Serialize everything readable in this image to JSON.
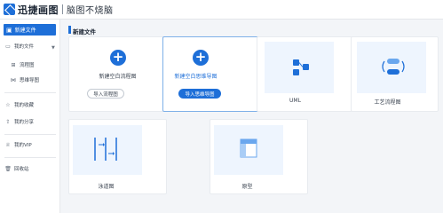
{
  "app": {
    "brand": "迅捷画图",
    "subtitle": "脑图不烧脑"
  },
  "sidebar": {
    "new_file": "新建文件",
    "my_files": "我的文件",
    "flowchart": "流程图",
    "mindmap": "思维导图",
    "favorites": "我的收藏",
    "share": "我的分享",
    "vip": "我的VIP",
    "recycle": "回收站"
  },
  "main": {
    "section_title": "新建文件",
    "cards": {
      "flowchart": {
        "label": "新建空白流程图",
        "button": "导入流程图"
      },
      "mindmap": {
        "label": "新建空白思维导图",
        "button": "导入思维导图"
      },
      "uml": {
        "label": "UML"
      },
      "process": {
        "label": "工艺流程图"
      },
      "swimlane": {
        "label": "泳道图"
      },
      "prototype": {
        "label": "原型"
      }
    }
  },
  "colors": {
    "accent": "#1e6fd8",
    "thumb_bg": "#eef5fe"
  }
}
